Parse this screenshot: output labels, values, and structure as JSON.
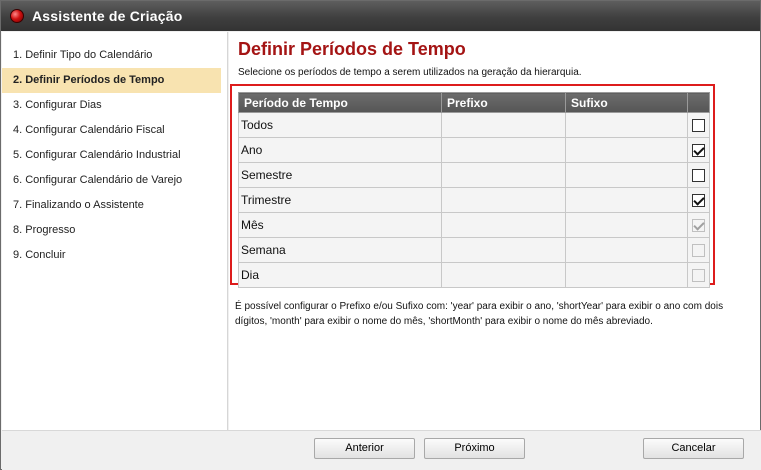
{
  "window": {
    "title": "Assistente de Criação"
  },
  "sidebar": {
    "steps": [
      {
        "label": "1. Definir Tipo do Calendário"
      },
      {
        "label": "2. Definir Períodos de Tempo"
      },
      {
        "label": "3. Configurar Dias"
      },
      {
        "label": "4. Configurar Calendário Fiscal"
      },
      {
        "label": "5. Configurar Calendário Industrial"
      },
      {
        "label": "6. Configurar Calendário de Varejo"
      },
      {
        "label": "7. Finalizando o Assistente"
      },
      {
        "label": "8. Progresso"
      },
      {
        "label": "9. Concluir"
      }
    ],
    "active_index": 1
  },
  "main": {
    "heading": "Definir Períodos de Tempo",
    "subtitle": "Selecione os períodos de tempo a serem utilizados na geração da hierarquia.",
    "table": {
      "columns": [
        "Período de Tempo",
        "Prefixo",
        "Sufixo",
        ""
      ],
      "rows": [
        {
          "period": "Todos",
          "prefix": "",
          "suffix": "",
          "checked": false,
          "enabled": true
        },
        {
          "period": "Ano",
          "prefix": "",
          "suffix": "",
          "checked": true,
          "enabled": true
        },
        {
          "period": "Semestre",
          "prefix": "",
          "suffix": "",
          "checked": false,
          "enabled": true
        },
        {
          "period": "Trimestre",
          "prefix": "",
          "suffix": "",
          "checked": true,
          "enabled": true
        },
        {
          "period": "Mês",
          "prefix": "",
          "suffix": "",
          "checked": true,
          "enabled": false
        },
        {
          "period": "Semana",
          "prefix": "",
          "suffix": "",
          "checked": false,
          "enabled": false
        },
        {
          "period": "Dia",
          "prefix": "",
          "suffix": "",
          "checked": false,
          "enabled": false
        }
      ]
    },
    "hint": "É possível configurar o Prefixo e/ou Sufixo com: 'year' para exibir o ano, 'shortYear' para exibir o ano com dois dígitos, 'month' para exibir o nome do mês, 'shortMonth' para exibir o nome do mês abreviado."
  },
  "footer": {
    "back_label": "Anterior",
    "next_label": "Próximo",
    "cancel_label": "Cancelar"
  },
  "colors": {
    "heading": "#a41414",
    "highlight_border": "#dd1c1c",
    "active_step": "#f8e3b0"
  }
}
